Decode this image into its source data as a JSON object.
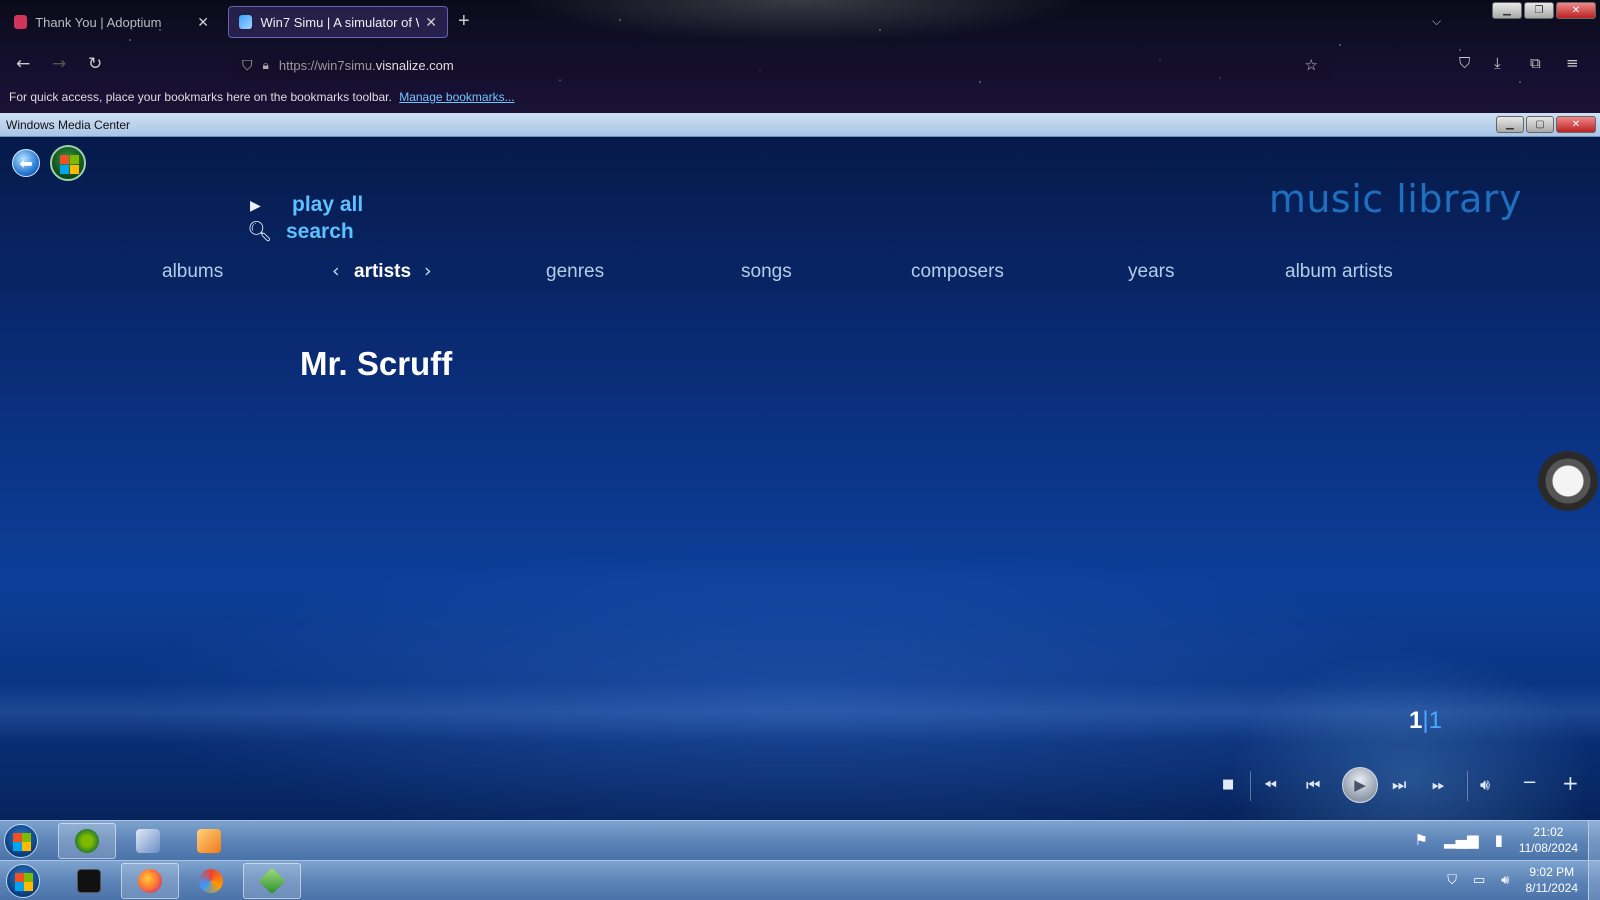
{
  "browser": {
    "tabs": [
      {
        "title": "Thank You | Adoptium",
        "active": false
      },
      {
        "title": "Win7 Simu | A simulator of Win",
        "active": true
      }
    ],
    "url": {
      "prefix": "https://win7simu.",
      "domain": "visnalize.com"
    },
    "bookmarks_notice": "For quick access, place your bookmarks here on the bookmarks toolbar.",
    "manage_bookmarks": "Manage bookmarks..."
  },
  "wmc": {
    "window_title": "Windows Media Center",
    "page_title": "music library",
    "actions": {
      "play_all": "play all",
      "search": "search"
    },
    "categories": [
      "albums",
      "artists",
      "genres",
      "songs",
      "composers",
      "years",
      "album artists"
    ],
    "active_category": "artists",
    "artist": "Mr. Scruff",
    "page_counter": {
      "current": "1",
      "separator": "|",
      "total": "1"
    }
  },
  "taskbar_top": {
    "time": "21:02",
    "date": "11/08/2024"
  },
  "taskbar_bottom": {
    "time": "9:02 PM",
    "date": "8/11/2024"
  },
  "icons": {
    "back": "back-arrow-icon",
    "start": "windows-logo-icon",
    "play": "play-icon",
    "search": "magnifier-icon",
    "transport": [
      "stop-icon",
      "rewind-icon",
      "skip-back-icon",
      "play-icon",
      "skip-forward-icon",
      "fast-forward-icon",
      "volume-icon",
      "volume-down-icon",
      "volume-up-icon"
    ]
  },
  "colors": {
    "accent": "#5ec0ff",
    "title": "#1f6fbf",
    "wmc_bg": "#0a2d78",
    "taskbar": "#5e85b8"
  }
}
